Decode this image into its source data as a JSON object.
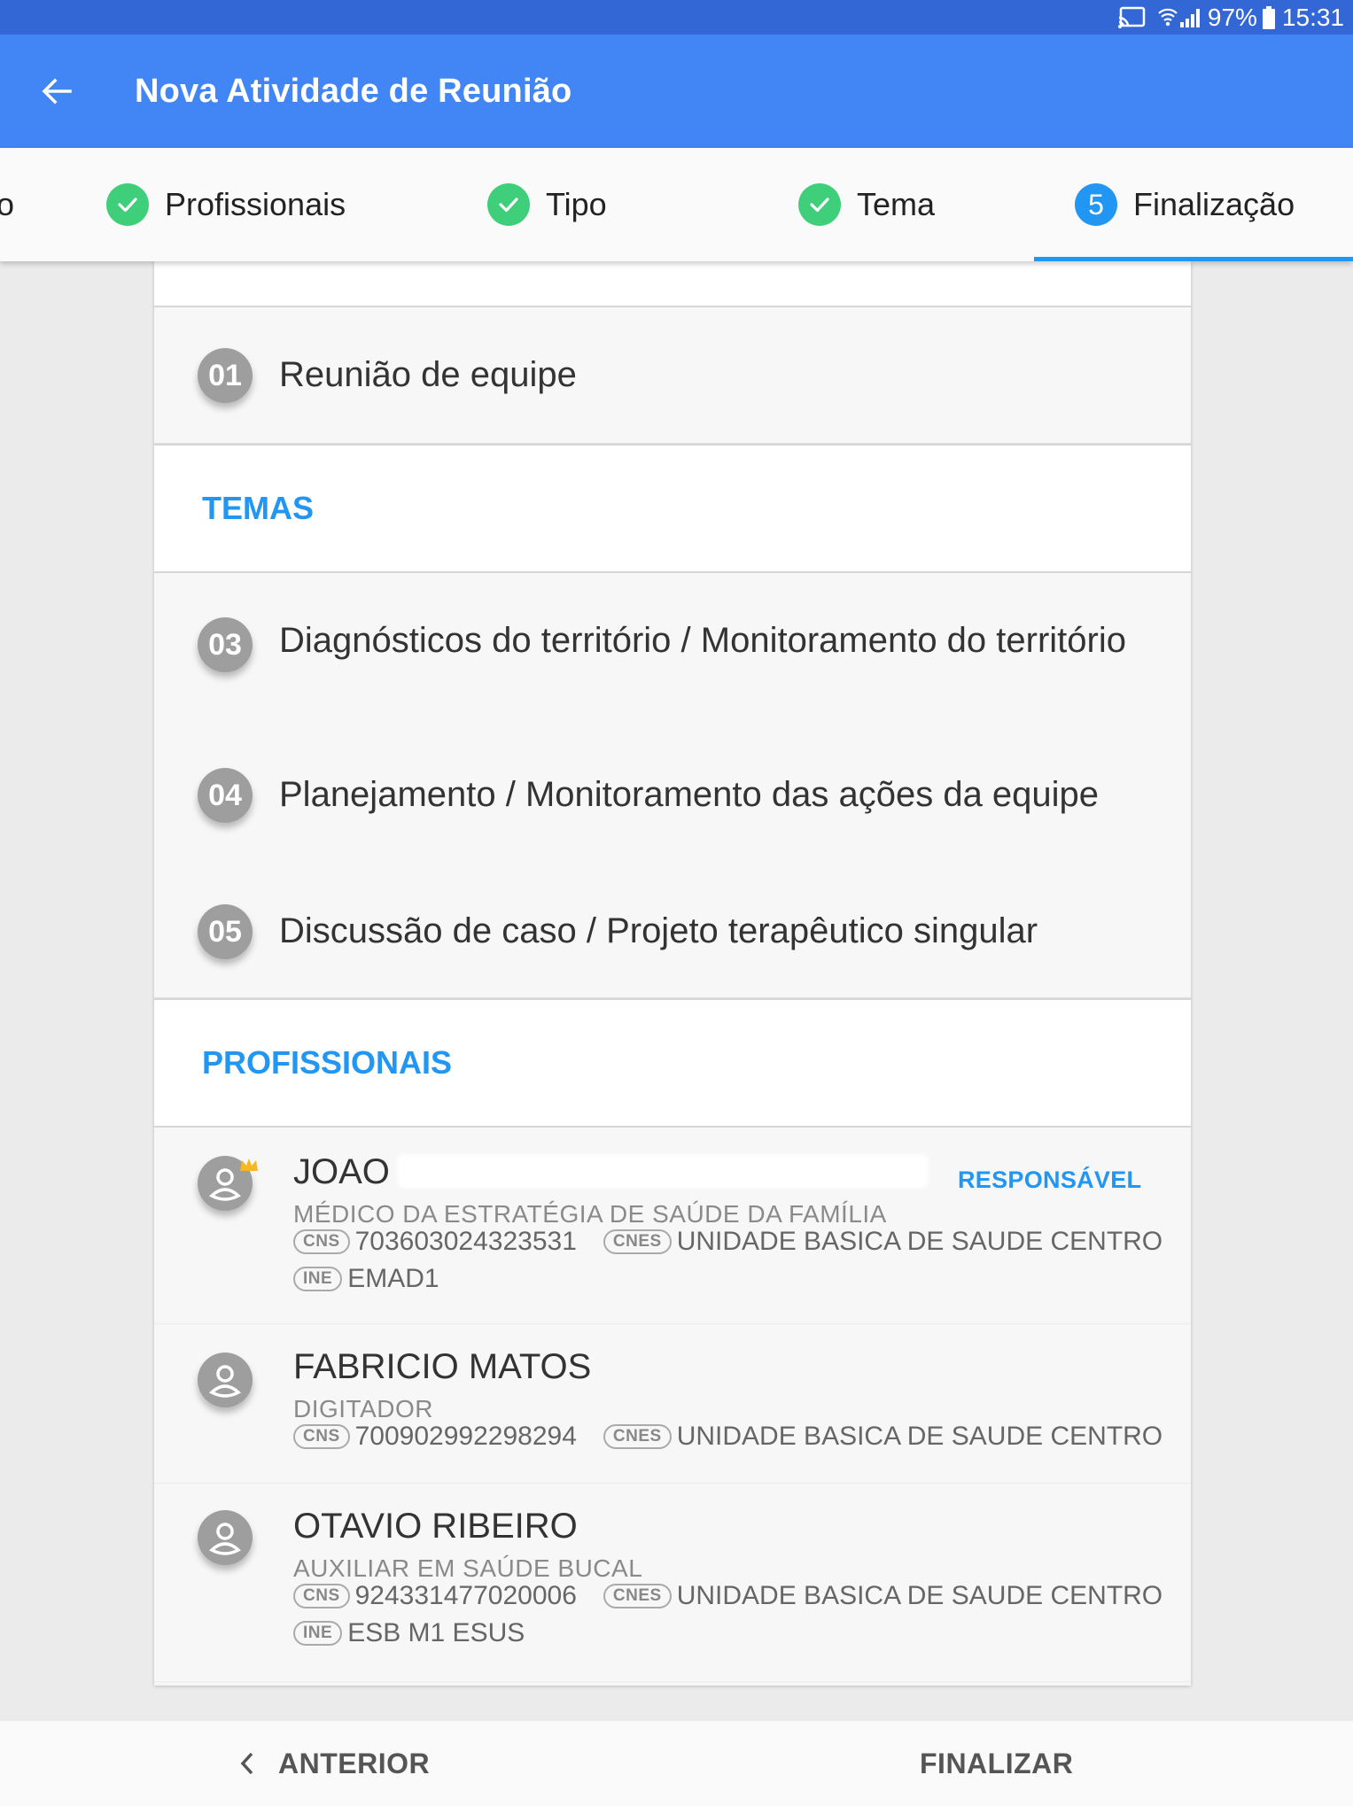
{
  "status_bar": {
    "battery": "97%",
    "time": "15:31"
  },
  "app_bar": {
    "title": "Nova Atividade de Reunião"
  },
  "stepper": {
    "steps": [
      {
        "label": "o",
        "state": "done"
      },
      {
        "label": "Profissionais",
        "state": "done"
      },
      {
        "label": "Tipo",
        "state": "done"
      },
      {
        "label": "Tema",
        "state": "done"
      },
      {
        "number": "5",
        "label": "Finalização",
        "state": "active"
      }
    ]
  },
  "tipo": {
    "number": "01",
    "label": "Reunião de equipe"
  },
  "temas": {
    "header": "TEMAS",
    "items": [
      {
        "number": "03",
        "label": "Diagnósticos do território / Monitoramento do território"
      },
      {
        "number": "04",
        "label": "Planejamento / Monitoramento das ações da equipe"
      },
      {
        "number": "05",
        "label": "Discussão de caso / Projeto terapêutico singular"
      }
    ]
  },
  "profissionais": {
    "header": "PROFISSIONAIS",
    "badge_responsavel": "RESPONSÁVEL",
    "tag_cns": "CNS",
    "tag_cnes": "CNES",
    "tag_ine": "INE",
    "items": [
      {
        "name": "JOAO",
        "role": "MÉDICO DA ESTRATÉGIA DE SAÚDE DA FAMÍLIA",
        "cns": "703603024323531",
        "cnes": "UNIDADE BASICA DE SAUDE CENTRO",
        "ine": "EMAD1",
        "responsavel": true
      },
      {
        "name": "FABRICIO MATOS",
        "role": "DIGITADOR",
        "cns": "700902992298294",
        "cnes": "UNIDADE BASICA DE SAUDE CENTRO",
        "responsavel": false
      },
      {
        "name": "OTAVIO RIBEIRO",
        "role": "AUXILIAR EM SAÚDE BUCAL",
        "cns": "924331477020006",
        "cnes": "UNIDADE BASICA DE SAUDE CENTRO",
        "ine": "ESB M1 ESUS",
        "responsavel": false
      }
    ]
  },
  "footer": {
    "previous": "ANTERIOR",
    "finish": "FINALIZAR"
  },
  "colors": {
    "primary": "#4285f4",
    "status_bar": "#3367d6",
    "accent": "#2196f3",
    "success": "#3fcf7a",
    "number_badge": "#9e9e9e"
  }
}
